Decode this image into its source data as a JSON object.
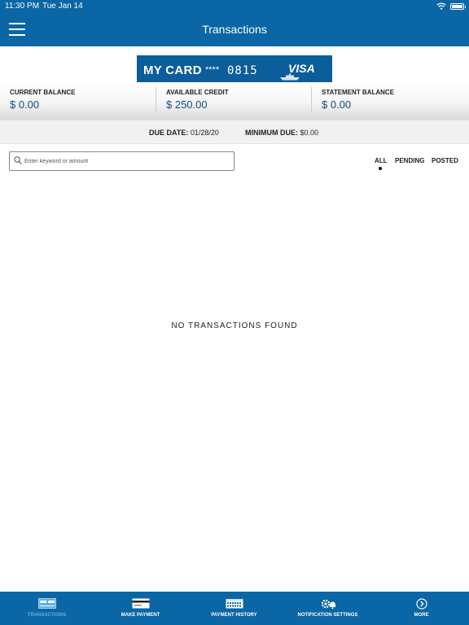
{
  "status": {
    "time": "11:30 PM",
    "date": "Tue Jan 14"
  },
  "header": {
    "title": "Transactions"
  },
  "card": {
    "name": "MY CARD",
    "masked": "****",
    "last4": "0815",
    "brand": "VISA"
  },
  "balances": [
    {
      "label": "CURRENT BALANCE",
      "value": "$ 0.00"
    },
    {
      "label": "AVAILABLE CREDIT",
      "value": "$ 250.00"
    },
    {
      "label": "STATEMENT BALANCE",
      "value": "$ 0.00"
    }
  ],
  "due": {
    "due_date_label": "DUE DATE:",
    "due_date_value": "01/28/20",
    "minimum_due_label": "MINIMUM DUE:",
    "minimum_due_value": "$0.00"
  },
  "search": {
    "placeholder": "Enter keyword or amount",
    "value": ""
  },
  "filters": {
    "items": [
      "ALL",
      "PENDING",
      "POSTED"
    ],
    "selected": "ALL"
  },
  "empty_message": "NO TRANSACTIONS FOUND",
  "tabs": [
    {
      "label": "TRANSACTIONS",
      "icon": "card-icon",
      "active": true
    },
    {
      "label": "MAKE PAYMENT",
      "icon": "payment-card-icon",
      "active": false
    },
    {
      "label": "PAYMENT HISTORY",
      "icon": "calendar-icon",
      "active": false
    },
    {
      "label": "NOTIFICATION SETTINGS",
      "icon": "gear-bell-icon",
      "active": false
    },
    {
      "label": "MORE",
      "icon": "chevron-right-circle-icon",
      "active": false
    }
  ],
  "colors": {
    "brand_blue": "#0a66a4",
    "card_blue": "#0c5d9b",
    "active_tab": "#5ab0ea",
    "balance_text": "#0c4d83"
  }
}
